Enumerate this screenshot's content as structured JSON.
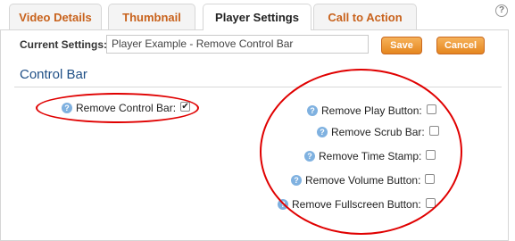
{
  "tabs": [
    {
      "label": "Video Details"
    },
    {
      "label": "Thumbnail"
    },
    {
      "label": "Player Settings"
    },
    {
      "label": "Call to Action"
    }
  ],
  "help_glyph": "?",
  "settings": {
    "label": "Current Settings:",
    "value": "Player Example - Remove Control Bar",
    "save_label": "Save",
    "cancel_label": "Cancel"
  },
  "section": {
    "title": "Control Bar"
  },
  "options": {
    "remove_control_bar": {
      "label": "Remove Control Bar:",
      "checked": true
    },
    "remove_play_button": {
      "label": "Remove Play Button:",
      "checked": false
    },
    "remove_scrub_bar": {
      "label": "Remove Scrub Bar:",
      "checked": false
    },
    "remove_time_stamp": {
      "label": "Remove Time Stamp:",
      "checked": false
    },
    "remove_volume_button": {
      "label": "Remove Volume Button:",
      "checked": false
    },
    "remove_fullscreen_button": {
      "label": "Remove Fullscreen Button:",
      "checked": false
    }
  },
  "check_glyph": "✔",
  "colors": {
    "tab_text": "#c8621c",
    "section_title": "#1f4f86",
    "button": "#e5861f",
    "annotation": "#e00000"
  }
}
